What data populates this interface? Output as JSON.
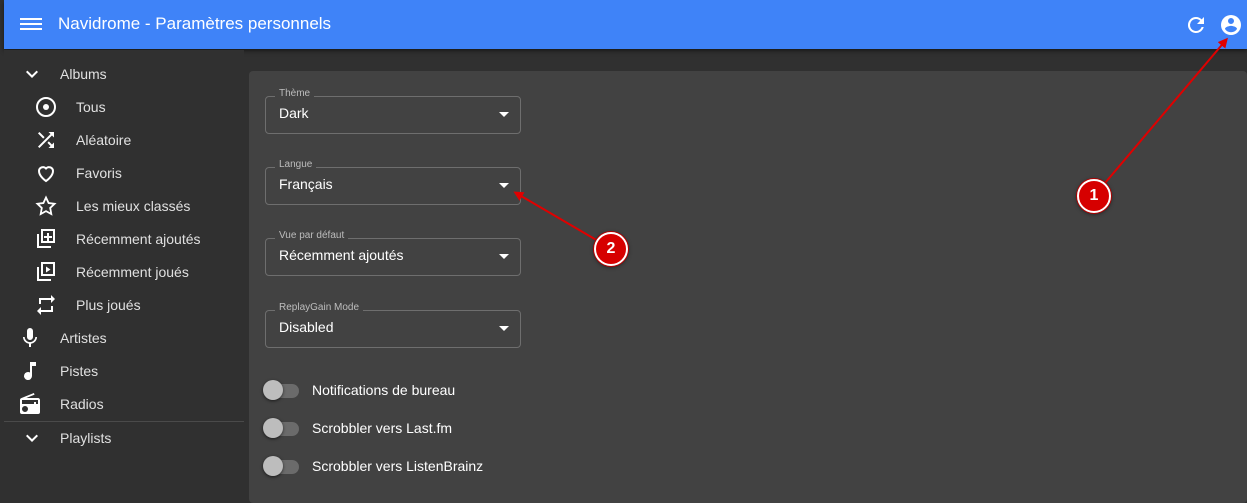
{
  "appbar": {
    "title": "Navidrome - Paramètres personnels",
    "icons": [
      "menu-icon",
      "refresh-icon",
      "account-circle-icon"
    ]
  },
  "sidebar": {
    "albums_label": "Albums",
    "album_items": [
      {
        "label": "Tous",
        "icon": "album-icon"
      },
      {
        "label": "Aléatoire",
        "icon": "shuffle-icon"
      },
      {
        "label": "Favoris",
        "icon": "heart-icon"
      },
      {
        "label": "Les mieux classés",
        "icon": "star-icon"
      },
      {
        "label": "Récemment ajoutés",
        "icon": "library-add-icon"
      },
      {
        "label": "Récemment joués",
        "icon": "video-library-icon"
      },
      {
        "label": "Plus joués",
        "icon": "repeat-icon"
      }
    ],
    "artists_label": "Artistes",
    "tracks_label": "Pistes",
    "radios_label": "Radios",
    "playlists_label": "Playlists"
  },
  "settings": {
    "theme": {
      "label": "Thème",
      "value": "Dark"
    },
    "language": {
      "label": "Langue",
      "value": "Français"
    },
    "default_view": {
      "label": "Vue par défaut",
      "value": "Récemment ajoutés"
    },
    "replaygain": {
      "label": "ReplayGain Mode",
      "value": "Disabled"
    },
    "toggles": [
      {
        "label": "Notifications de bureau",
        "on": false
      },
      {
        "label": "Scrobbler vers Last.fm",
        "on": false
      },
      {
        "label": "Scrobbler vers ListenBrainz",
        "on": false
      }
    ]
  },
  "annotations": {
    "badge1": "1",
    "badge2": "2",
    "color": "#d60000"
  },
  "colors": {
    "appbar": "#3f83f8",
    "background": "#303030",
    "panel": "#424242"
  }
}
